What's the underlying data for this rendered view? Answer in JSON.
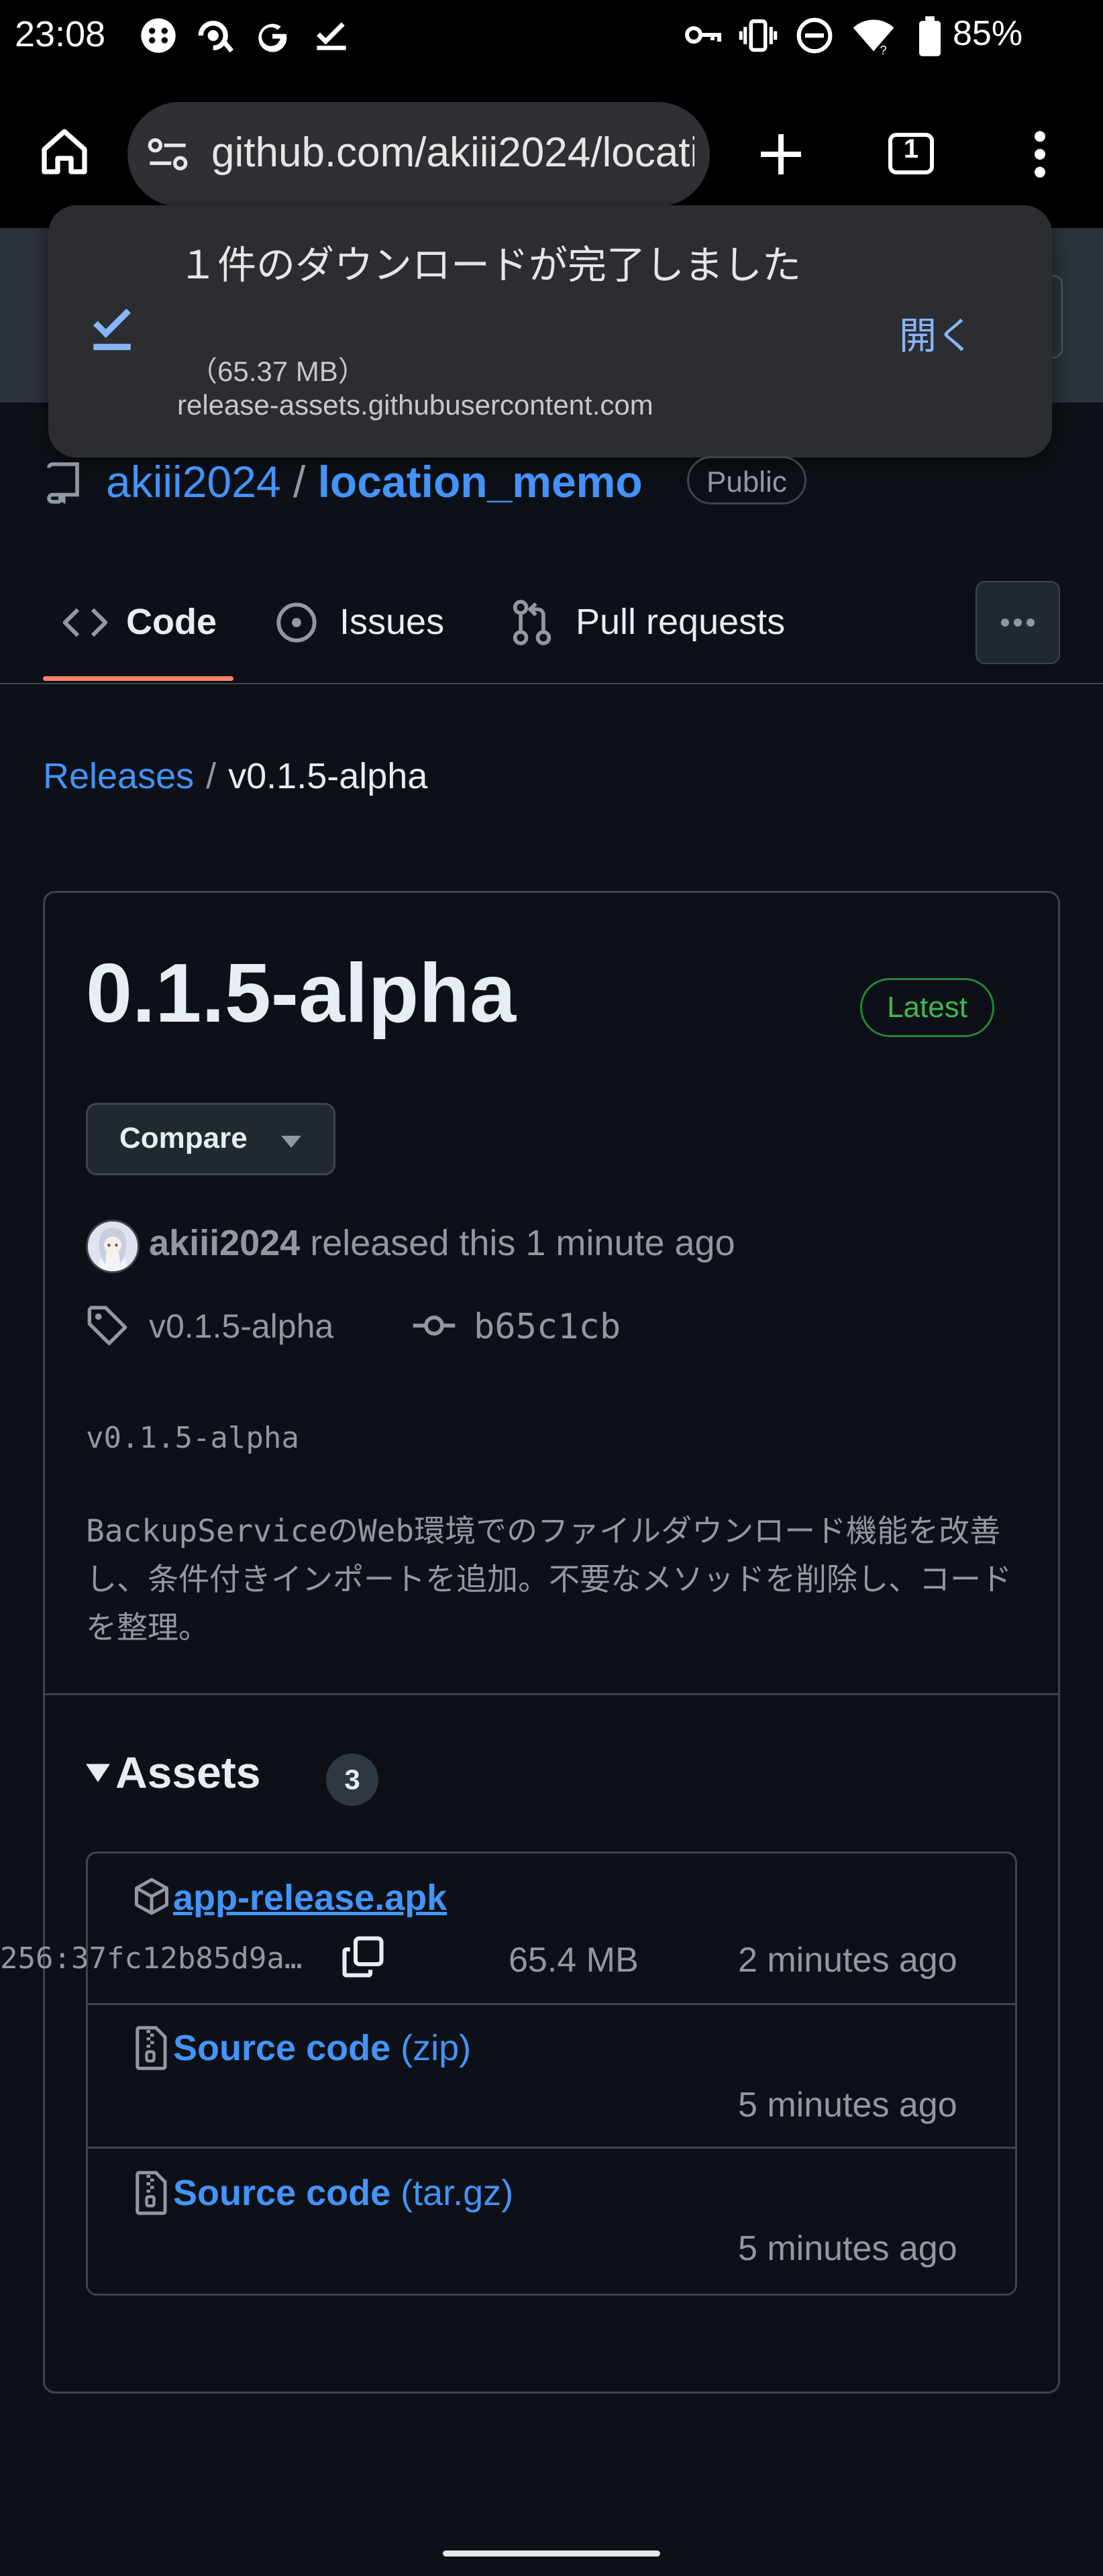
{
  "status_bar": {
    "time": "23:08",
    "battery": "85%",
    "left_icons": [
      "game-controller-icon",
      "voice-assistant-icon",
      "google-g-icon",
      "task-check-icon"
    ],
    "right_icons": [
      "key-icon",
      "vibrate-icon",
      "do-not-disturb-icon",
      "wifi-icon",
      "battery-icon"
    ]
  },
  "browser": {
    "url": "github.com/akiii2024/location_memo",
    "tab_count": "1"
  },
  "toast": {
    "title": "１件のダウンロードが完了しました",
    "size": "（65.37 MB）",
    "host": "release-assets.githubusercontent.com",
    "open_label": "開く"
  },
  "repo": {
    "owner": "akiii2024",
    "separator": "/",
    "name": "location_memo",
    "visibility": "Public"
  },
  "tabs": [
    {
      "label": "Code",
      "active": true
    },
    {
      "label": "Issues",
      "active": false
    },
    {
      "label": "Pull requests",
      "active": false
    }
  ],
  "breadcrumb": {
    "root": "Releases",
    "separator": "/",
    "current": "v0.1.5-alpha"
  },
  "release": {
    "title": "0.1.5-alpha",
    "badge": "Latest",
    "compare_label": "Compare",
    "author": "akiii2024",
    "released_text": "released this 1 minute ago",
    "tag": "v0.1.5-alpha",
    "commit": "b65c1cb",
    "body_tag": "v0.1.5-alpha",
    "body_desc": "BackupServiceのWeb環境でのファイルダウンロード機能を改善し、条件付きインポートを追加。不要なメソッドを削除し、コードを整理。"
  },
  "assets": {
    "heading": "Assets",
    "count": "3",
    "items": [
      {
        "name": "app-release.apk",
        "suffix": "",
        "digest": "256:37fc12b85d9a…",
        "size": "65.4 MB",
        "time": "2 minutes ago"
      },
      {
        "name": "Source code",
        "suffix": "(zip)",
        "time": "5 minutes ago"
      },
      {
        "name": "Source code",
        "suffix": "(tar.gz)",
        "time": "5 minutes ago"
      }
    ]
  },
  "colors": {
    "background": "#0d1117",
    "link": "#4493f8",
    "muted": "#9198a1",
    "latest_green": "#3fb950",
    "tab_underline": "#f78166",
    "toast_bg": "#2b2d31",
    "toast_action": "#8ab4f8"
  }
}
